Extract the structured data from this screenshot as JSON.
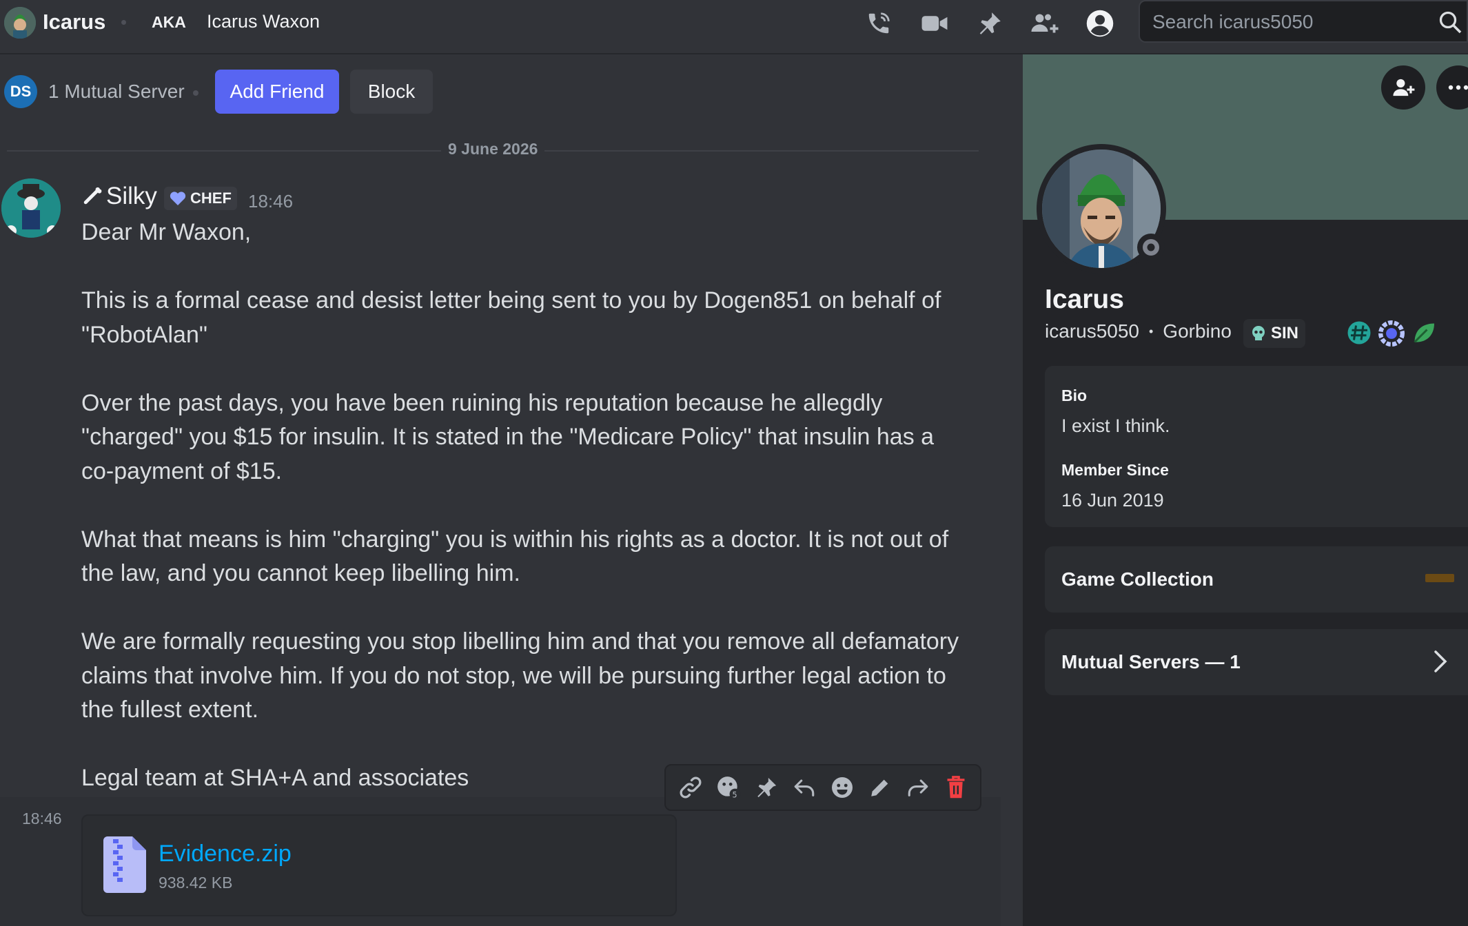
{
  "header": {
    "name": "Icarus",
    "aka_label": "AKA",
    "aka_name": "Icarus Waxon",
    "search_placeholder": "Search icarus5050",
    "icons": [
      "voice-call-icon",
      "video-call-icon",
      "pin-icon",
      "add-friends-to-dm-icon",
      "user-profile-icon",
      "search-icon"
    ]
  },
  "mutual_bar": {
    "server_initials": "DS",
    "mutual_text": "1 Mutual Server",
    "add_friend_label": "Add Friend",
    "block_label": "Block"
  },
  "divider": {
    "date": "9 June 2026"
  },
  "message": {
    "author": "Silky",
    "role_tag": "CHEF",
    "time": "18:46",
    "paragraphs": [
      "Dear Mr Waxon,",
      "This is a formal cease and desist letter being sent to you by Dogen851 on behalf of \"RobotAlan\"",
      "Over the past days, you have been ruining his reputation because he allegdly \"charged\" you $15 for insulin. It is stated in the \"Medicare Policy\" that insulin has a co-payment of $15.",
      "What that means is him \"charging\" you is within his rights as a doctor.  It is not out of the law, and you cannot keep libelling him.",
      "We are formally requesting you stop libelling him and that you remove all defamatory claims that involve him. If you do not stop, we will be pursuing further legal action to the fullest extent.",
      "Legal team at SHA+A and associates"
    ]
  },
  "attachment": {
    "time": "18:46",
    "file_name": "Evidence.zip",
    "file_size": "938.42 KB"
  },
  "toolbar": {
    "icons": [
      "copy-link-icon",
      "add-reaction-super-icon",
      "pin-message-icon",
      "reply-icon",
      "add-reaction-icon",
      "edit-icon",
      "forward-icon",
      "delete-icon"
    ]
  },
  "profile": {
    "display_name": "Icarus",
    "username": "icarus5050",
    "pronoun_or_name": "Gorbino",
    "server_tag": "SIN",
    "bio_title": "Bio",
    "bio_text": "I exist I think.",
    "member_since_title": "Member Since",
    "member_since_date": "16 Jun 2019",
    "game_collection_label": "Game Collection",
    "mutual_servers_label": "Mutual Servers — 1",
    "banner_color": "#4d6660"
  },
  "colors": {
    "accent": "#5865f2",
    "link": "#00a8fc",
    "danger": "#f23f43",
    "bg": "#313338"
  }
}
